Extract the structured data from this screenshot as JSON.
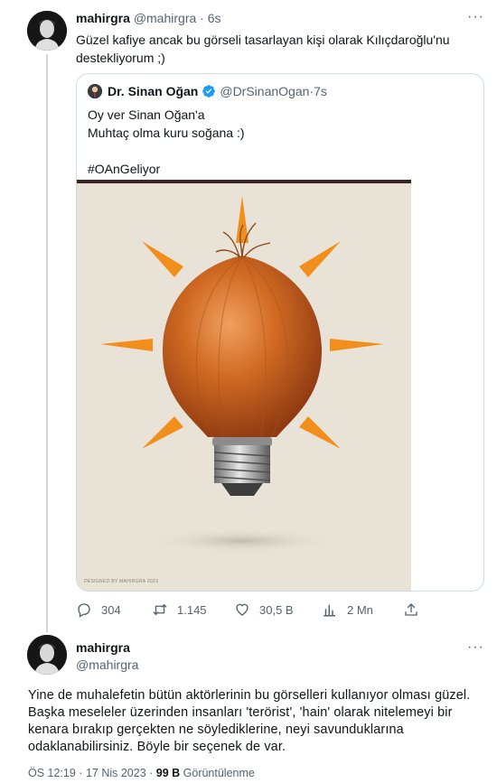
{
  "tweet": {
    "author_name": "mahirgra",
    "author_handle": "@mahirgra",
    "time_sep": " · ",
    "time": "6s",
    "more_label": "···",
    "text": "Güzel kafiye ancak bu görseli tasarlayan kişi olarak Kılıçdaroğlu'nu destekliyorum ;)"
  },
  "quote": {
    "author_name": "Dr. Sinan Oğan",
    "author_handle": "@DrSinanOgan",
    "time_sep": " · ",
    "time": "7s",
    "line1": "Oy ver Sinan Oğan'a",
    "line2": "Muhtaç olma kuru soğana :)",
    "hashtag": "#OAnGeliyor",
    "image_credit": "DESIGNED BY MAHIRGRA 2023",
    "colors": {
      "sunray": "#f28f1c",
      "onion": "#c8601c",
      "background": "#e8e3d6"
    }
  },
  "actions": {
    "replies": "304",
    "retweets": "1.145",
    "likes": "30,5 B",
    "views": "2 Mn"
  },
  "reply": {
    "author_name": "mahirgra",
    "author_handle": "@mahirgra",
    "more_label": "···",
    "text": "Yine de muhalefetin bütün aktörlerinin bu görselleri kullanıyor olması güzel. Başka meseleler üzerinden insanları 'terörist', 'hain' olarak nitelemeyi bir kenara bırakıp gerçekten ne söylediklerine, neyi savunduklarına odaklanabilirsiniz. Böyle bir seçenek de var.",
    "time": "ÖS 12:19",
    "sep": " · ",
    "date": "17 Nis 2023",
    "sep2": " · ",
    "views_count": "99 B",
    "views_label": " Görüntülenme"
  }
}
